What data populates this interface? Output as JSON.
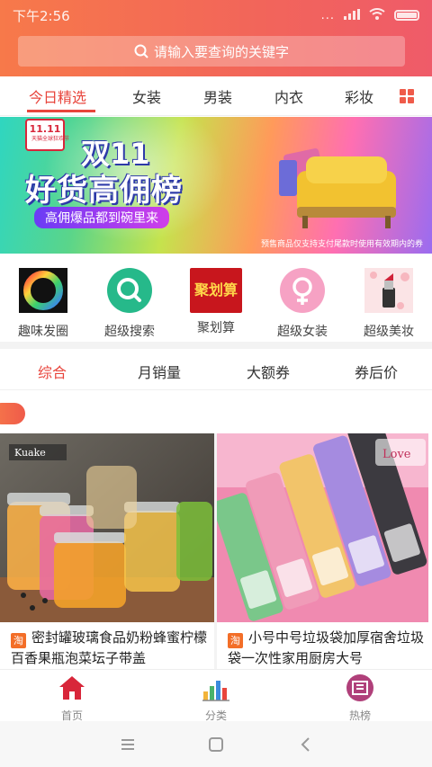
{
  "status_bar": {
    "time": "下午2:56",
    "dots": "...",
    "signal_icon": "signal-icon",
    "wifi_icon": "wifi-icon"
  },
  "search": {
    "placeholder": "请输入要查询的关键字"
  },
  "tabs": [
    {
      "label": "今日精选",
      "active": true
    },
    {
      "label": "女装"
    },
    {
      "label": "男装"
    },
    {
      "label": "内衣"
    },
    {
      "label": "彩妆"
    }
  ],
  "banner": {
    "badge": "天猫全球狂欢节",
    "title_line1": "双11",
    "title_line2": "好货高佣榜",
    "subtitle": "高佣爆品都到碗里来",
    "note": "预售商品仅支持支付尾款时使用有效期内的券"
  },
  "categories": [
    {
      "label": "趣味发圈",
      "icon": "ring-icon"
    },
    {
      "label": "超级搜索",
      "icon": "search-icon"
    },
    {
      "label": "聚划算",
      "icon": "juhuasuan-icon",
      "icon_text": "聚划算"
    },
    {
      "label": "超级女装",
      "icon": "female-icon"
    },
    {
      "label": "超级美妆",
      "icon": "lipstick-icon"
    }
  ],
  "sort_options": [
    {
      "label": "综合",
      "active": true
    },
    {
      "label": "月销量"
    },
    {
      "label": "大额券"
    },
    {
      "label": "券后价"
    }
  ],
  "products": [
    {
      "title": "密封罐玻璃食品奶粉蜂蜜柠檬百香果瓶泡菜坛子带盖",
      "brand_text": "Kuake",
      "badge": "淘"
    },
    {
      "title": "小号中号垃圾袋加厚宿舍垃圾袋一次性家用厨房大号",
      "badge": "淘",
      "brand_text": "Love"
    }
  ],
  "bottom_nav": [
    {
      "label": "首页",
      "icon": "home-icon"
    },
    {
      "label": "分类",
      "icon": "chart-icon"
    },
    {
      "label": "热榜",
      "icon": "hotlist-icon"
    }
  ],
  "colors": {
    "accent": "#e8453c",
    "header_start": "#f7794a",
    "header_end": "#ef5b69"
  }
}
